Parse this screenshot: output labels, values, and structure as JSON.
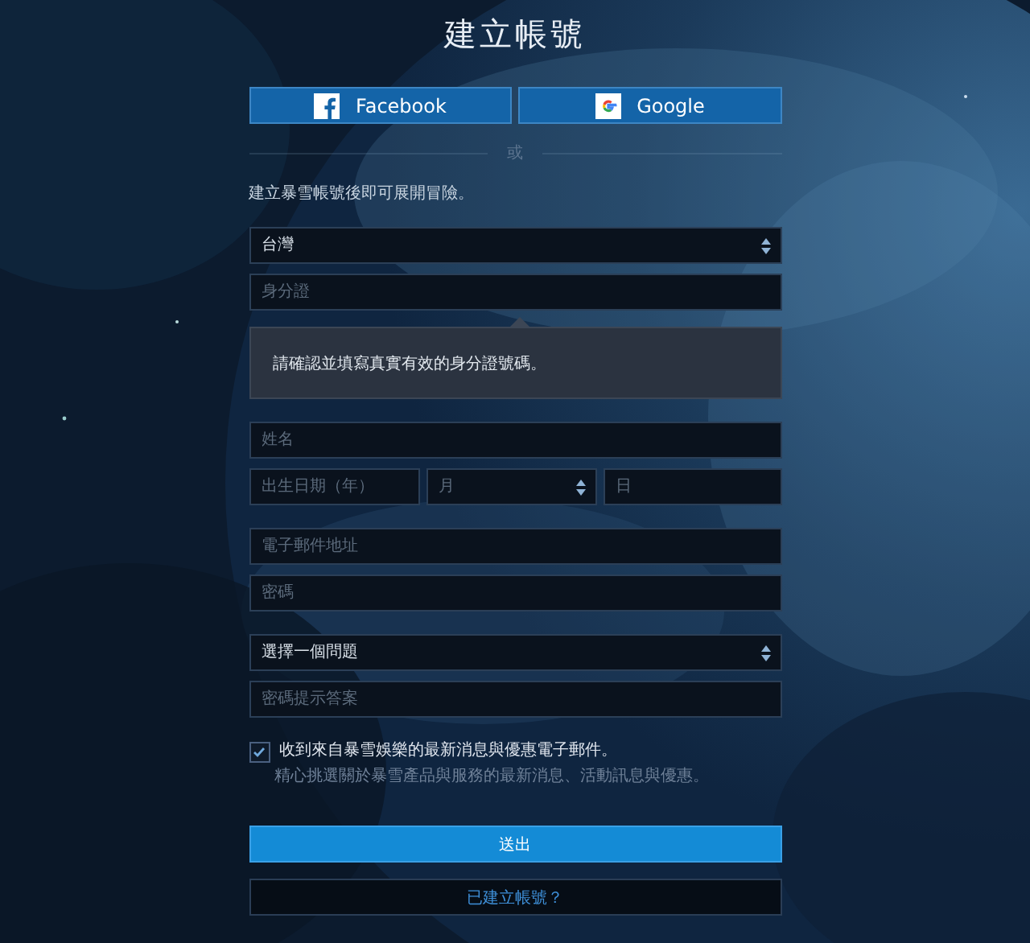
{
  "title": "建立帳號",
  "social_buttons": [
    {
      "label": "Facebook",
      "kind": "facebook"
    },
    {
      "label": "Google",
      "kind": "google"
    }
  ],
  "divider": "或",
  "intro": "建立暴雪帳號後即可展開冒險。",
  "groups": [
    {
      "rows": [
        [
          {
            "kind": "select",
            "value": "台灣"
          }
        ],
        [
          {
            "kind": "input",
            "placeholder": "身分證"
          }
        ]
      ]
    },
    {
      "tooltip": "請確認並填寫真實有效的身分證號碼。"
    },
    {
      "rows": [
        [
          {
            "kind": "input",
            "placeholder": "姓名"
          }
        ],
        [
          {
            "kind": "input",
            "placeholder": "出生日期（年）"
          },
          {
            "kind": "select",
            "placeholder": "月"
          },
          {
            "kind": "input",
            "placeholder": "日"
          }
        ]
      ]
    },
    {
      "rows": [
        [
          {
            "kind": "input",
            "placeholder": "電子郵件地址"
          }
        ],
        [
          {
            "kind": "input",
            "placeholder": "密碼"
          }
        ]
      ]
    },
    {
      "rows": [
        [
          {
            "kind": "select",
            "value": "選擇一個問題"
          }
        ],
        [
          {
            "kind": "input",
            "placeholder": "密碼提示答案"
          }
        ]
      ]
    }
  ],
  "newsletter": {
    "label": "收到來自暴雪娛樂的最新消息與優惠電子郵件。",
    "sublabel": "精心挑選關於暴雪產品與服務的最新消息、活動訊息與優惠。",
    "checked": true
  },
  "submit": "送出",
  "login_link": "已建立帳號？"
}
